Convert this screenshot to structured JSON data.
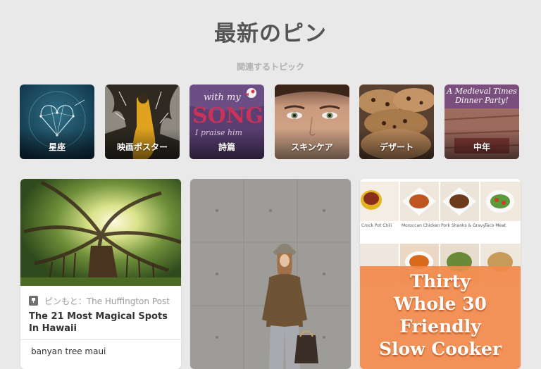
{
  "page": {
    "title": "最新のピン",
    "related_label": "関連するトピック"
  },
  "topics": [
    {
      "label": "星座",
      "icon": "constellation-heart-image"
    },
    {
      "label": "映画ポスター",
      "icon": "movie-poster-image"
    },
    {
      "label": "詩篇",
      "icon": "song-typography-image"
    },
    {
      "label": "スキンケア",
      "icon": "face-closeup-image"
    },
    {
      "label": "デザート",
      "icon": "cookies-image"
    },
    {
      "label": "中年",
      "icon": "medieval-dinner-image",
      "image_text": "A Medieval Times Dinner Party!"
    }
  ],
  "pins": [
    {
      "source": "ピンもと：The Huffington Post",
      "title": "The 21 Most Magical Spots In Hawaii",
      "description": "banyan tree maui",
      "image": "banyan-tree-photo"
    },
    {
      "image": "woman-concrete-wall-photo"
    },
    {
      "image": "slow-cooker-collage",
      "grid_captions": [
        "Crock Pot Chili",
        "Moroccan Chicken",
        "Pork Shanks & Gravy",
        "Taco Meat"
      ],
      "overlay_lines": [
        "Thirty",
        "Whole 30",
        "Friendly",
        "Slow Cooker"
      ]
    }
  ],
  "colors": {
    "background": "#e9e9e9",
    "title": "#555555",
    "overlay_orange": "#f2894a"
  }
}
